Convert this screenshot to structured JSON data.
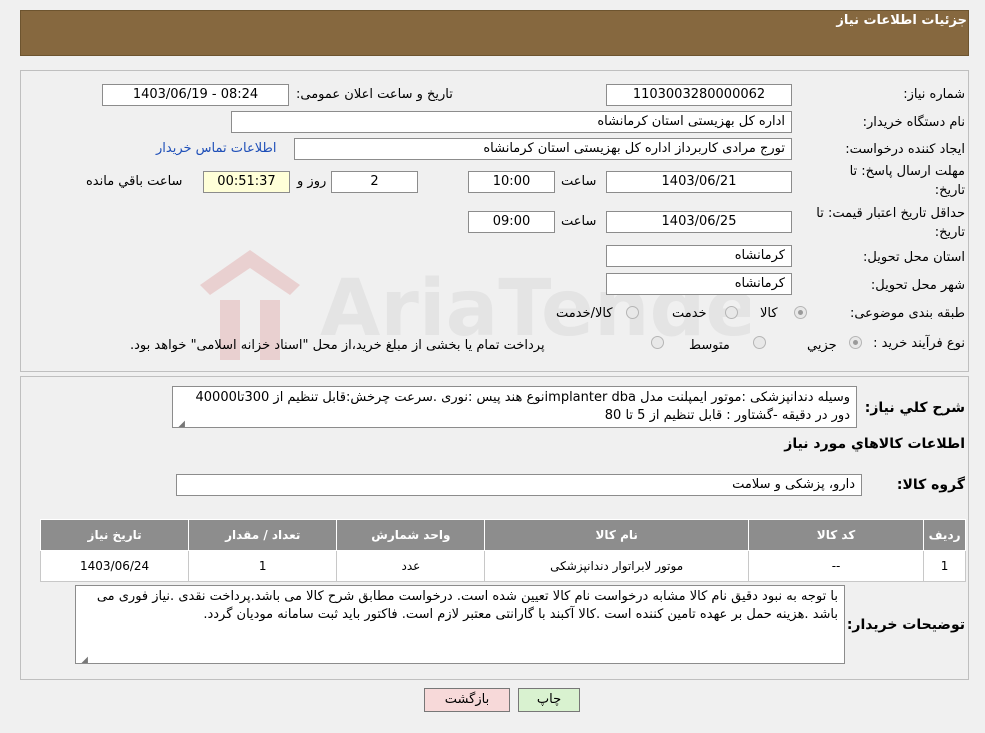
{
  "header": {
    "title": "جزئیات اطلاعات نیاز"
  },
  "fields": {
    "need_number_label": "شماره نیاز:",
    "need_number": "1103003280000062",
    "announce_label": "تاریخ و ساعت اعلان عمومی:",
    "announce_value": "1403/06/19 - 08:24",
    "buyer_org_label": "نام دستگاه خریدار:",
    "buyer_org": "اداره کل بهزیستی استان کرمانشاه",
    "creator_label": "ایجاد کننده درخواست:",
    "creator": "تورج مرادی کاربرداز  اداره کل بهزیستی استان کرمانشاه",
    "contact_link": "اطلاعات تماس خریدار",
    "deadline_label_1": "مهلت ارسال پاسخ: تا",
    "deadline_label_2": "تاریخ:",
    "deadline_date": "1403/06/21",
    "time_word": "ساعت",
    "deadline_time": "10:00",
    "days_value": "2",
    "days_word": "روز و",
    "remaining_time": "00:51:37",
    "remaining_word": "ساعت باقي مانده",
    "validity_label_1": "حداقل تاریخ اعتبار قیمت: تا",
    "validity_label_2": "تاریخ:",
    "validity_date": "1403/06/25",
    "validity_time": "09:00",
    "province_label": "استان محل تحویل:",
    "province": "کرمانشاه",
    "city_label": "شهر محل تحویل:",
    "city": "کرمانشاه",
    "category_label": "طبقه بندی موضوعی:",
    "category_options": [
      "کالا",
      "خدمت",
      "کالا/خدمت"
    ],
    "purchase_label": "نوع فرآیند خرید :",
    "purchase_options": [
      "جزیي",
      "متوسط"
    ],
    "purchase_note": "پرداخت تمام یا بخشی از مبلغ خرید،از محل \"اسناد خزانه اسلامی\" خواهد بود."
  },
  "description": {
    "label": "شرح کلي نیاز:",
    "text": "وسیله دندانپزشکی :موتور ایمپلنت مدل implanter dbaنوع هند پیس :نوری .سرعت چرخش:قابل تنظیم از 300تا40000 دور در دقیقه -گشتاور : قابل تنظیم از 5 تا 80"
  },
  "goods_info_title": "اطلاعات کالاهاي مورد نياز",
  "goods_group": {
    "label": "گروه کالا:",
    "value": "دارو، پزشکی و سلامت"
  },
  "table": {
    "headers": [
      "ردیف",
      "کد کالا",
      "نام کالا",
      "واحد شمارش",
      "تعداد / مقدار",
      "تاریخ نیاز"
    ],
    "rows": [
      [
        "1",
        "--",
        "موتور لابراتوار دندانپزشکی",
        "عدد",
        "1",
        "1403/06/24"
      ]
    ]
  },
  "buyer_notes": {
    "label": "توضیحات خریدار:",
    "text": "با توجه به نبود دقیق نام کالا  مشابه درخواست نام کالا تعیین شده است. درخواست مطابق شرح کالا می باشد.پرداخت نقدی .نیاز فوری می باشد .هزینه حمل بر عهده تامین کننده است .کالا آکبند با گارانتی معتبر لازم است. فاکتور باید ثبت سامانه مودیان گردد."
  },
  "buttons": {
    "print": "چاپ",
    "back": "بازگشت"
  },
  "watermark_text": "AriaTender.neT",
  "colors": {
    "header": "#86683f",
    "back_button": "#f7d9d9",
    "print_button": "#d9f2d0",
    "link": "#1e4fb8"
  }
}
